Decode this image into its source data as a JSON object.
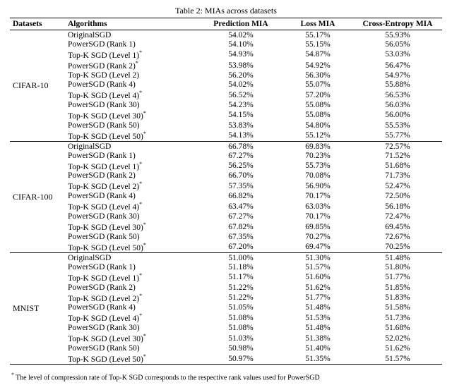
{
  "caption": "Table 2: MIAs across datasets",
  "headers": {
    "datasets": "Datasets",
    "algorithms": "Algorithms",
    "prediction": "Prediction MIA",
    "loss": "Loss MIA",
    "ce": "Cross-Entropy MIA"
  },
  "groups": [
    {
      "name": "CIFAR-10",
      "rows": [
        {
          "algo": "OriginalSGD",
          "star": false,
          "p": "54.02%",
          "l": "55.17%",
          "c": "55.93%"
        },
        {
          "algo": "PowerSGD (Rank 1)",
          "star": false,
          "p": "54.10%",
          "l": "55.15%",
          "c": "56.05%"
        },
        {
          "algo": "Top-K SGD (Level 1)",
          "star": true,
          "p": "54.93%",
          "l": "54.87%",
          "c": "53.03%"
        },
        {
          "algo": "PowerSGD (Rank 2)",
          "star": true,
          "p": "53.98%",
          "l": "54.92%",
          "c": "56.47%"
        },
        {
          "algo": "Top-K SGD (Level 2)",
          "star": false,
          "p": "56.20%",
          "l": "56.30%",
          "c": "54.97%"
        },
        {
          "algo": "PowerSGD (Rank 4)",
          "star": false,
          "p": "54.02%",
          "l": "55.07%",
          "c": "55.88%"
        },
        {
          "algo": "Top-K SGD (Level 4)",
          "star": true,
          "p": "56.52%",
          "l": "57.20%",
          "c": "56.53%"
        },
        {
          "algo": "PowerSGD (Rank 30)",
          "star": false,
          "p": "54.23%",
          "l": "55.08%",
          "c": "56.03%"
        },
        {
          "algo": "Top-K SGD (Level 30)",
          "star": true,
          "p": "54.15%",
          "l": "55.08%",
          "c": "56.00%"
        },
        {
          "algo": "PowerSGD (Rank 50)",
          "star": false,
          "p": "53.83%",
          "l": "54.80%",
          "c": "55.53%"
        },
        {
          "algo": "Top-K SGD (Level 50)",
          "star": true,
          "p": "54.13%",
          "l": "55.12%",
          "c": "55.77%"
        }
      ]
    },
    {
      "name": "CIFAR-100",
      "rows": [
        {
          "algo": "OriginalSGD",
          "star": false,
          "p": "66.78%",
          "l": "69.83%",
          "c": "72.57%"
        },
        {
          "algo": "PowerSGD (Rank 1)",
          "star": false,
          "p": "67.27%",
          "l": "70.23%",
          "c": "71.52%"
        },
        {
          "algo": "Top-K SGD (Level 1)",
          "star": true,
          "p": "56.25%",
          "l": "55.73%",
          "c": "51.68%"
        },
        {
          "algo": "PowerSGD (Rank 2)",
          "star": false,
          "p": "66.70%",
          "l": "70.08%",
          "c": "71.73%"
        },
        {
          "algo": "Top-K SGD (Level 2)",
          "star": true,
          "p": "57.35%",
          "l": "56.90%",
          "c": "52.47%"
        },
        {
          "algo": "PowerSGD (Rank 4)",
          "star": false,
          "p": "66.82%",
          "l": "70.17%",
          "c": "72.50%"
        },
        {
          "algo": "Top-K SGD (Level 4)",
          "star": true,
          "p": "63.47%",
          "l": "63.03%",
          "c": "56.18%"
        },
        {
          "algo": "PowerSGD (Rank 30)",
          "star": false,
          "p": "67.27%",
          "l": "70.17%",
          "c": "72.47%"
        },
        {
          "algo": "Top-K SGD (Level 30)",
          "star": true,
          "p": "67.82%",
          "l": "69.85%",
          "c": "69.45%"
        },
        {
          "algo": "PowerSGD (Rank 50)",
          "star": false,
          "p": "67.35%",
          "l": "70.27%",
          "c": "72.67%"
        },
        {
          "algo": "Top-K SGD (Level 50)",
          "star": true,
          "p": "67.20%",
          "l": "69.47%",
          "c": "70.25%"
        }
      ]
    },
    {
      "name": "MNIST",
      "rows": [
        {
          "algo": "OriginalSGD",
          "star": false,
          "p": "51.00%",
          "l": "51.30%",
          "c": "51.48%"
        },
        {
          "algo": "PowerSGD (Rank 1)",
          "star": false,
          "p": "51.18%",
          "l": "51.57%",
          "c": "51.80%"
        },
        {
          "algo": "Top-K SGD (Level 1)",
          "star": true,
          "p": "51.17%",
          "l": "51.60%",
          "c": "51.77%"
        },
        {
          "algo": "PowerSGD (Rank 2)",
          "star": false,
          "p": "51.22%",
          "l": "51.62%",
          "c": "51.85%"
        },
        {
          "algo": "Top-K SGD (Level 2)",
          "star": true,
          "p": "51.22%",
          "l": "51.77%",
          "c": "51.83%"
        },
        {
          "algo": "PowerSGD (Rank 4)",
          "star": false,
          "p": "51.05%",
          "l": "51.48%",
          "c": "51.58%"
        },
        {
          "algo": "Top-K SGD (Level 4)",
          "star": true,
          "p": "51.08%",
          "l": "51.53%",
          "c": "51.73%"
        },
        {
          "algo": "PowerSGD (Rank 30)",
          "star": false,
          "p": "51.08%",
          "l": "51.48%",
          "c": "51.68%"
        },
        {
          "algo": "Top-K SGD (Level 30)",
          "star": true,
          "p": "51.03%",
          "l": "51.38%",
          "c": "52.02%"
        },
        {
          "algo": "PowerSGD (Rank 50)",
          "star": false,
          "p": "50.98%",
          "l": "51.40%",
          "c": "51.62%"
        },
        {
          "algo": "Top-K SGD (Level 50)",
          "star": true,
          "p": "50.97%",
          "l": "51.35%",
          "c": "51.57%"
        }
      ]
    }
  ],
  "footnote": "The level of compression rate of Top-K SGD corresponds to the respective rank values used for PowerSGD"
}
